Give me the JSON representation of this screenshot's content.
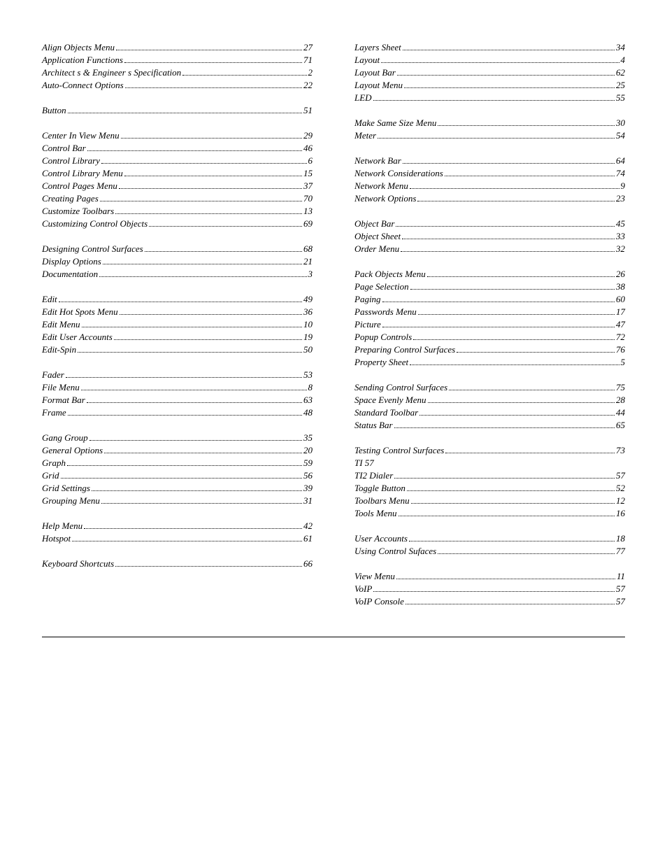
{
  "left_column": {
    "sections": [
      {
        "entries": [
          {
            "title": "Align Objects Menu",
            "page": "27"
          },
          {
            "title": "Application Functions",
            "page": "71"
          },
          {
            "title": "Architect s & Engineer s Specification",
            "page": "2"
          },
          {
            "title": "Auto-Connect Options",
            "page": "22"
          }
        ]
      },
      {
        "entries": [
          {
            "title": "Button",
            "page": "51"
          }
        ]
      },
      {
        "entries": [
          {
            "title": "Center In View Menu",
            "page": "29"
          },
          {
            "title": "Control Bar",
            "page": "46"
          },
          {
            "title": "Control Library",
            "page": "6"
          },
          {
            "title": "Control Library Menu",
            "page": "15"
          },
          {
            "title": "Control Pages Menu",
            "page": "37"
          },
          {
            "title": "Creating Pages",
            "page": "70"
          },
          {
            "title": "Customize Toolbars",
            "page": "13"
          },
          {
            "title": "Customizing Control Objects",
            "page": "69"
          }
        ]
      },
      {
        "entries": [
          {
            "title": "Designing Control Surfaces",
            "page": "68"
          },
          {
            "title": "Display Options",
            "page": "21"
          },
          {
            "title": "Documentation",
            "page": "3"
          }
        ]
      },
      {
        "entries": [
          {
            "title": "Edit",
            "page": "49"
          },
          {
            "title": "Edit Hot Spots Menu",
            "page": "36"
          },
          {
            "title": "Edit Menu",
            "page": "10"
          },
          {
            "title": "Edit User Accounts",
            "page": "19"
          },
          {
            "title": "Edit-Spin",
            "page": "50"
          }
        ]
      },
      {
        "entries": [
          {
            "title": "Fader",
            "page": "53"
          },
          {
            "title": "File Menu",
            "page": "8"
          },
          {
            "title": "Format Bar",
            "page": "63"
          },
          {
            "title": "Frame",
            "page": "48"
          }
        ]
      },
      {
        "entries": [
          {
            "title": "Gang Group",
            "page": "35"
          },
          {
            "title": "General Options",
            "page": "20"
          },
          {
            "title": "Graph",
            "page": "59"
          },
          {
            "title": "Grid",
            "page": "56"
          },
          {
            "title": "Grid Settings",
            "page": "39"
          },
          {
            "title": "Grouping Menu",
            "page": "31"
          }
        ]
      },
      {
        "entries": [
          {
            "title": "Help Menu",
            "page": "42"
          },
          {
            "title": "Hotspot",
            "page": "61"
          }
        ]
      },
      {
        "entries": [
          {
            "title": "Keyboard Shortcuts",
            "page": "66"
          }
        ]
      }
    ]
  },
  "right_column": {
    "sections": [
      {
        "entries": [
          {
            "title": "Layers Sheet",
            "page": "34"
          },
          {
            "title": "Layout",
            "page": "4"
          },
          {
            "title": "Layout Bar",
            "page": "62"
          },
          {
            "title": "Layout Menu",
            "page": "25"
          },
          {
            "title": "LED",
            "page": "55"
          }
        ]
      },
      {
        "entries": [
          {
            "title": "Make Same Size Menu",
            "page": "30"
          },
          {
            "title": "Meter",
            "page": "54"
          }
        ]
      },
      {
        "entries": [
          {
            "title": "Network Bar",
            "page": "64"
          },
          {
            "title": "Network Considerations",
            "page": "74"
          },
          {
            "title": "Network Menu",
            "page": "9"
          },
          {
            "title": "Network Options",
            "page": "23"
          }
        ]
      },
      {
        "entries": [
          {
            "title": "Object Bar",
            "page": "45"
          },
          {
            "title": "Object Sheet",
            "page": "33"
          },
          {
            "title": "Order Menu",
            "page": "32"
          }
        ]
      },
      {
        "entries": [
          {
            "title": "Pack Objects Menu",
            "page": "26"
          },
          {
            "title": "Page Selection",
            "page": "38"
          },
          {
            "title": "Paging",
            "page": "60"
          },
          {
            "title": "Passwords Menu",
            "page": "17"
          },
          {
            "title": "Picture",
            "page": "47"
          },
          {
            "title": "Popup Controls",
            "page": "72"
          },
          {
            "title": "Preparing Control Surfaces",
            "page": "76"
          },
          {
            "title": "Property Sheet",
            "page": "5"
          }
        ]
      },
      {
        "entries": [
          {
            "title": "Sending Control Surfaces",
            "page": "75"
          },
          {
            "title": "Space Evenly Menu",
            "page": "28"
          },
          {
            "title": "Standard Toolbar",
            "page": "44"
          },
          {
            "title": "Status Bar",
            "page": "65"
          }
        ]
      },
      {
        "entries": [
          {
            "title": "Testing Control Surfaces",
            "page": "73"
          },
          {
            "title": "TI 57",
            "page": ""
          },
          {
            "title": "TI2 Dialer",
            "page": "57"
          },
          {
            "title": "Toggle Button",
            "page": "52"
          },
          {
            "title": "Toolbars Menu",
            "page": "12"
          },
          {
            "title": "Tools Menu",
            "page": "16"
          }
        ]
      },
      {
        "entries": [
          {
            "title": "User Accounts",
            "page": "18"
          },
          {
            "title": "Using Control Sufaces",
            "page": "77"
          }
        ]
      },
      {
        "entries": [
          {
            "title": "View Menu",
            "page": "11"
          },
          {
            "title": "VoIP",
            "page": "57"
          },
          {
            "title": "VoIP Console",
            "page": "57"
          }
        ]
      }
    ]
  }
}
